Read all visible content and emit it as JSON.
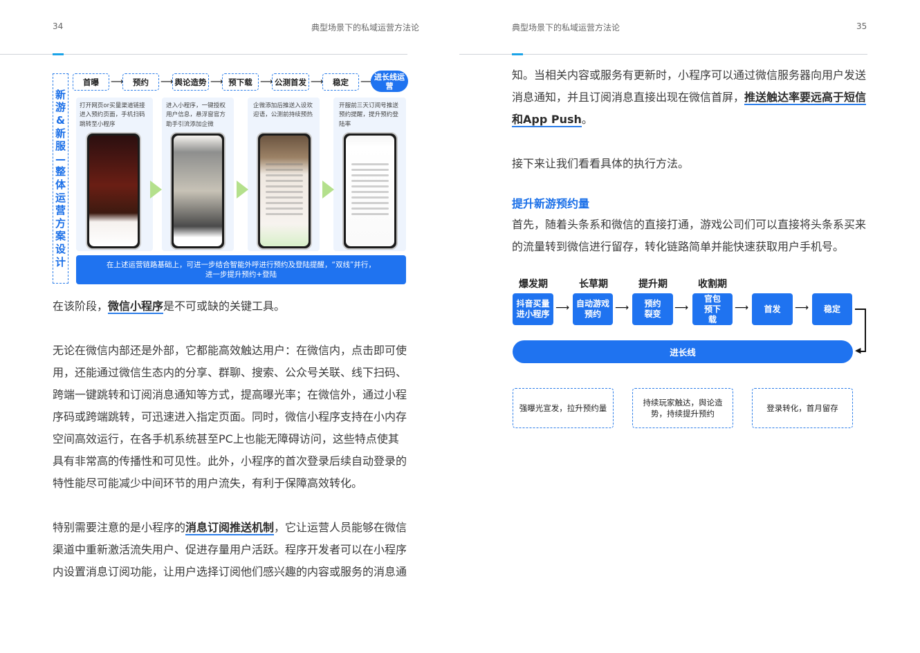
{
  "left_page": {
    "number": "34",
    "header": "典型场景下的私域运营方法论",
    "flow_title": "新游&新服—整体运营方案设计",
    "stages": [
      "首曝",
      "预约",
      "舆论造势",
      "预下载",
      "公测首发",
      "稳定"
    ],
    "final_stage": "进长线运营",
    "panels": [
      {
        "desc": "打开网页or买量渠道链接进入预约页面，手机扫码跳转至小程序"
      },
      {
        "desc": "进入小程序，一键授权用户信息，悬浮窗官方助手引流添加企微"
      },
      {
        "desc": "企微添加后推送入设欢迎语，公测前持续预热"
      },
      {
        "desc": "开服前三天订阅号推送预约提醒，提升预约登陆率"
      }
    ],
    "banner": [
      "在上述运营链路基础上，可进一步结合智能外呼进行预约及登陆提醒，“双线”并行，",
      "进一步提升预约+登陆"
    ],
    "para1": {
      "a": "在该阶段，",
      "b": "微信小程序",
      "c": "是不可或缺的关键工具。"
    },
    "para2": [
      "无论在微信内部还是外部，它都能高效触达用户：在微信内，点击即可使",
      "用，还能通过微信生态内的分享、群聊、搜索、公众号关联、线下扫码、",
      "跨端一键跳转和订阅消息通知等方式，提高曝光率；在微信外，通过小程",
      "序码或跨端跳转，可迅速进入指定页面。同时，微信小程序支持在小内存",
      "空间高效运行，在各手机系统甚至PC上也能无障碍访问，这些特点使其",
      "具有非常高的传播性和可见性。此外，小程序的首次登录后续自动登录的",
      "特性能尽可能减少中间环节的用户流失，有利于保障高效转化。"
    ],
    "para3": {
      "l1a": "特别需要注意的是小程序的",
      "l1b": "消息订阅推送机制",
      "l1c": "，它让运营人员能够在微信",
      "l2": "渠道中重新激活流失用户、促进存量用户活跃。程序开发者可以在小程序",
      "l3": "内设置消息订阅功能，让用户选择订阅他们感兴趣的内容或服务的消息通"
    }
  },
  "right_page": {
    "number": "35",
    "header": "典型场景下的私域运营方法论",
    "para1": {
      "l1": "知。当相关内容或服务有更新时，小程序可以通过微信服务器向用户发送",
      "l2a": "消息通知，并且订阅消息直接出现在微信首屏，",
      "l2b": "推送触达率要远高于短信",
      "l3b": "和App Push",
      "l3c": "。"
    },
    "para2": "接下来让我们看看具体的执行方法。",
    "section_title": "提升新游预约量",
    "para3": [
      "首先，随着头条系和微信的直接打通，游戏公司们可以直接将头条系买来",
      "的流量转到微信进行留存，转化链路简单并能快速获取用户手机号。"
    ],
    "phases": [
      "爆发期",
      "长草期",
      "提升期",
      "收割期"
    ],
    "boxes": [
      "抖音买量进小程序",
      "自动游戏预约",
      "预约裂变",
      "官包预下载",
      "首发",
      "稳定"
    ],
    "long_line": "进长线",
    "notes": [
      "强曝光宣发，拉升预约量",
      "持续玩家触达，舆论造势，持续提升预约",
      "登录转化，首月留存"
    ]
  },
  "colors": {
    "accent": "#1f73f0",
    "title_blue": "#1a6fe8",
    "arrow_green": "#b4e08c"
  }
}
